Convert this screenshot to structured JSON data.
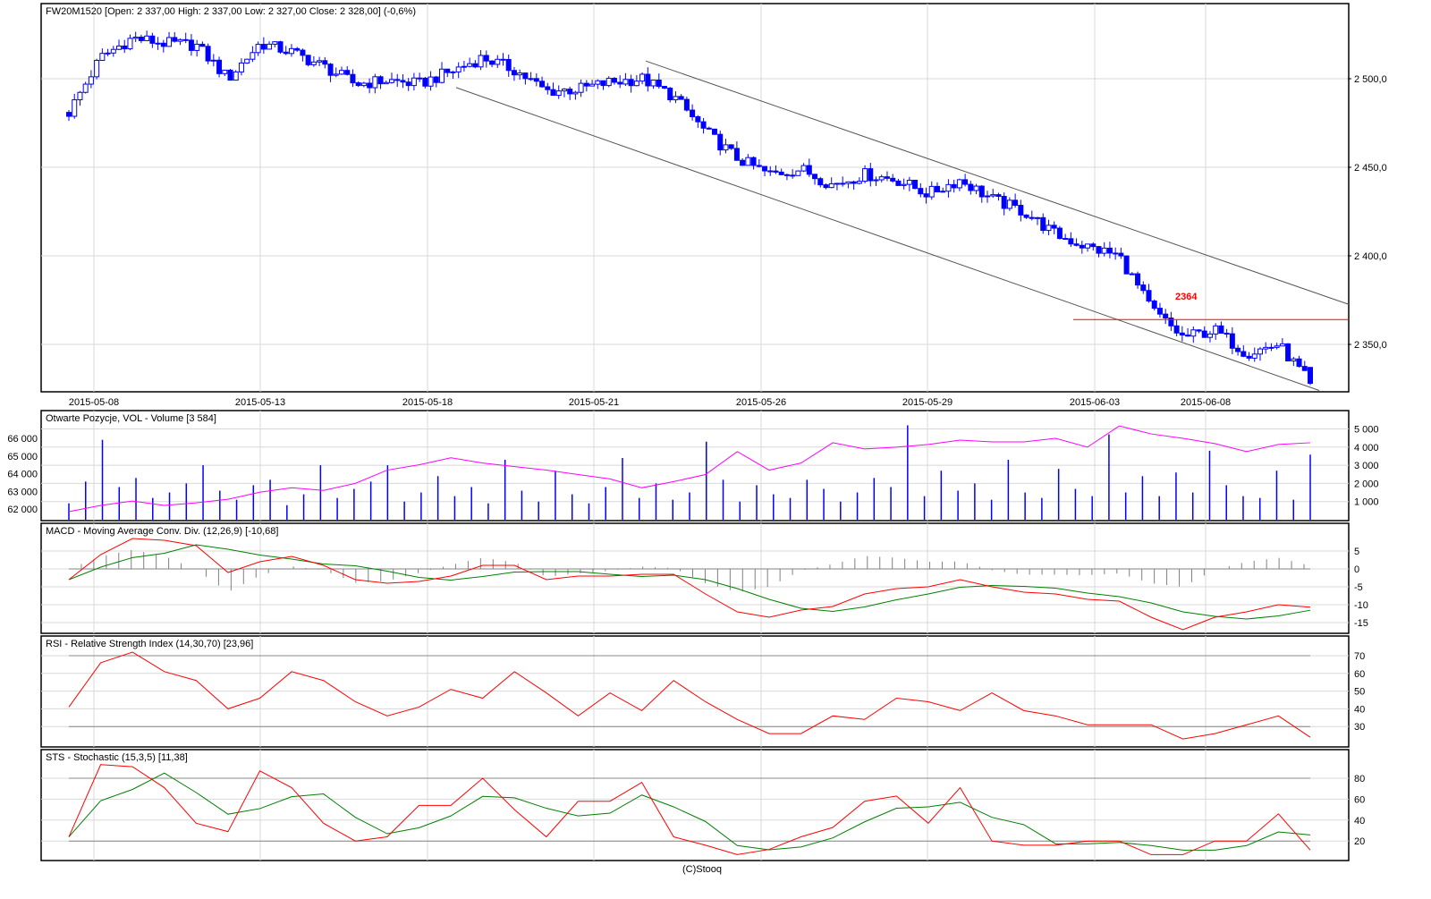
{
  "header": {
    "title": "FW20M1520 [Open: 2 337,00  High: 2 337,00  Low: 2 327,00  Close: 2 328,00] (-0,6%)",
    "volume_title": "Otwarte Pozycje, VOL - Volume [3 584]",
    "macd_title": "MACD - Moving Average Conv. Div. (12,26,9) [-10,68]",
    "rsi_title": "RSI - Relative Strength Index (14,30,70) [23,96]",
    "sts_title": "STS - Stochastic (15,3,5) [11,38]",
    "footer": "(C)Stooq"
  },
  "chart_data": [
    {
      "type": "candlestick",
      "title": "FW20M1520",
      "x_tick_labels": [
        "2015-05-08",
        "2015-05-13",
        "2015-05-18",
        "2015-05-21",
        "2015-05-26",
        "2015-05-29",
        "2015-06-03",
        "2015-06-08"
      ],
      "y_tick_labels": [
        "2 500,0",
        "2 450,0",
        "2 400,0",
        "2 350,0"
      ],
      "y_ticks": [
        2500,
        2450,
        2400,
        2350
      ],
      "ylim": [
        2323,
        2542
      ],
      "close_samples": [
        2481,
        2512,
        2523,
        2520,
        2519,
        2500,
        2520,
        2515,
        2507,
        2497,
        2499,
        2497,
        2504,
        2512,
        2505,
        2493,
        2494,
        2498,
        2500,
        2490,
        2470,
        2455,
        2446,
        2449,
        2440,
        2446,
        2443,
        2435,
        2443,
        2432,
        2425,
        2412,
        2405,
        2400,
        2370,
        2354,
        2358,
        2345,
        2350,
        2328
      ],
      "last_candle": {
        "open": 2337,
        "high": 2337,
        "low": 2327,
        "close": 2328
      },
      "channel_upper": [
        2510,
        2372.6
      ],
      "channel_lower": [
        2495,
        2324
      ],
      "level": {
        "value": 2364,
        "label": "2364",
        "color": "#ff0000"
      },
      "candle_color": "#0000ff"
    },
    {
      "type": "bar+line",
      "title": "Otwarte Pozycje, VOL - Volume",
      "volume_ticks": [
        5000,
        4000,
        3000,
        2000,
        1000
      ],
      "volume_tick_labels": [
        "5 000",
        "4 000",
        "3 000",
        "2 000",
        "1 000"
      ],
      "oi_ticks": [
        66000,
        65000,
        64000,
        63000,
        62000
      ],
      "oi_tick_labels": [
        "66 000",
        "65 000",
        "64 000",
        "63 000",
        "62 000"
      ],
      "volume": [
        900,
        2100,
        4400,
        1800,
        2300,
        1200,
        1500,
        2000,
        3000,
        1600,
        1100,
        1900,
        2200,
        800,
        1400,
        3000,
        1200,
        1700,
        2100,
        3000,
        1000,
        1500,
        2400,
        1300,
        1800,
        900,
        3300,
        1600,
        1000,
        2700,
        1400,
        900,
        1800,
        3400,
        1200,
        2000,
        1100,
        1500,
        4300,
        2200,
        1000,
        1900,
        1400,
        1200,
        2200,
        1700,
        1000,
        1500,
        2300,
        1800,
        5200,
        1300,
        2700,
        1600,
        2000,
        1100,
        3300,
        1500,
        1200,
        2800,
        1700,
        1300,
        4700,
        1500,
        2400,
        1300,
        2600,
        1500,
        3800,
        1900,
        1300,
        1200,
        2700,
        1100,
        3584
      ],
      "open_interest": [
        61850,
        62200,
        62450,
        62200,
        62350,
        62550,
        62950,
        63200,
        63050,
        63450,
        64200,
        64500,
        64900,
        64600,
        64400,
        64200,
        63950,
        63700,
        63200,
        63550,
        63950,
        65250,
        64200,
        64600,
        65750,
        65400,
        65500,
        65650,
        65900,
        65800,
        65800,
        66000,
        65500,
        66700,
        66250,
        66000,
        65700,
        65250,
        65650,
        65750
      ],
      "volume_color": "#0000ff",
      "oi_color": "#ff00ff"
    },
    {
      "type": "line",
      "title": "MACD (12,26,9)",
      "y_ticks": [
        5,
        0,
        -5,
        -10,
        -15
      ],
      "y_tick_labels": [
        "5",
        "0",
        "-5",
        "-10",
        "-15"
      ],
      "macd": [
        -3,
        4,
        8.5,
        8,
        6.5,
        -1,
        2,
        3.5,
        1,
        -3,
        -4,
        -3.5,
        -2,
        1,
        1,
        -3,
        -2,
        -2,
        -1.5,
        -1.5,
        -7,
        -12,
        -13.5,
        -11.5,
        -10.5,
        -7,
        -5.5,
        -5,
        -3,
        -5,
        -6.5,
        -7,
        -8.5,
        -9,
        -13.5,
        -17,
        -13.5,
        -12,
        -10,
        -10.68
      ],
      "signal_smoothing": 4,
      "macd_color": "#ff0000",
      "signal_color": "#008000",
      "histogram_color": "#808080"
    },
    {
      "type": "line",
      "title": "RSI (14,30,70)",
      "y_ticks": [
        70,
        60,
        50,
        40,
        30
      ],
      "y_tick_labels": [
        "70",
        "60",
        "50",
        "40",
        "30"
      ],
      "levels": [
        70,
        30
      ],
      "rsi": [
        41,
        66,
        72,
        61,
        56,
        40,
        46,
        61,
        56,
        44,
        36,
        41,
        51,
        46,
        61,
        49,
        36,
        49,
        39,
        56,
        44,
        34,
        26,
        26,
        36,
        34,
        46,
        44,
        39,
        49,
        39,
        36,
        31,
        31,
        31,
        23,
        26,
        31,
        36,
        23.96
      ],
      "color": "#ff0000"
    },
    {
      "type": "line",
      "title": "STS (15,3,5)",
      "y_ticks": [
        80,
        60,
        40,
        20
      ],
      "y_tick_labels": [
        "80",
        "60",
        "40",
        "20"
      ],
      "levels": [
        80,
        20
      ],
      "k": [
        24,
        93,
        91,
        71,
        37,
        29,
        87,
        71,
        37,
        20,
        24,
        54,
        54,
        80,
        50,
        24,
        58,
        58,
        76,
        24,
        16,
        7,
        12,
        24,
        33,
        58,
        63,
        37,
        71,
        20,
        16,
        16,
        20,
        20,
        7,
        7,
        20,
        20,
        46,
        11.38
      ],
      "d_smoothing": 3,
      "k_color": "#ff0000",
      "d_color": "#008000"
    }
  ]
}
